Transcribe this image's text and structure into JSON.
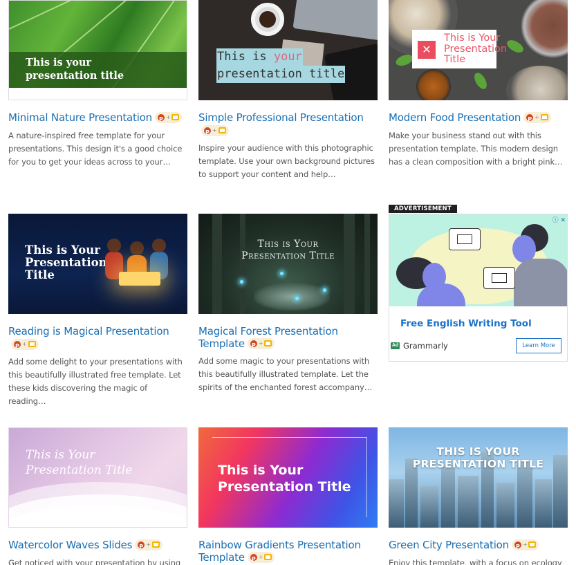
{
  "cards": [
    {
      "title": "Minimal Nature Presentation",
      "thumb_text": [
        "This is your",
        "presentation title"
      ],
      "description": "A nature-inspired free template for your presentations. This design it's a good choice for you to get your ideas across to your…"
    },
    {
      "title": "Simple Professional Presentation",
      "thumb_text": [
        "This is ",
        "your",
        "presentation title"
      ],
      "description": "Inspire your audience with this photographic template. Use your own background pictures to support your content and help…"
    },
    {
      "title": "Modern Food Presentation",
      "thumb_text": [
        "This is Your",
        "Presentation",
        "Title"
      ],
      "thumb_icon": "✕",
      "description": "Make your business stand out with this presentation template. This modern design has a clean composition with a bright pink…"
    },
    {
      "title": "Reading is Magical Presentation",
      "thumb_text": [
        "This is Your",
        "Presentation",
        "Title"
      ],
      "description": "Add some delight to your presentations with this beautifully illustrated free template. Let these kids discovering the magic of reading…"
    },
    {
      "title": "Magical Forest Presentation Template",
      "thumb_text": [
        "This is Your",
        "Presentation Title"
      ],
      "description": "Add some magic to your presentations with this beautifully illustrated template. Let the spirits of the enchanted forest accompany…"
    },
    {
      "title": "Watercolor Waves Slides",
      "thumb_text": [
        "This is Your",
        "Presentation Title"
      ],
      "description": "Get noticed with your presentation by using"
    },
    {
      "title": "Rainbow Gradients Presentation Template",
      "thumb_text": [
        "This is Your",
        "Presentation Title"
      ],
      "description": ""
    },
    {
      "title": "Green City Presentation",
      "thumb_text": [
        "THIS IS YOUR",
        "PRESENTATION TITLE"
      ],
      "description": "Enjoy this template, with a focus on ecology"
    }
  ],
  "badge": {
    "plus": "+"
  },
  "ad": {
    "label": "ADVERTISEMENT",
    "choice_icon": "ⓘ ✕",
    "headline": "Free English Writing Tool",
    "ad_tag": "Ad",
    "brand": "Grammarly",
    "cta": "Learn More"
  },
  "colors": {
    "title_link": "#1b6fb3",
    "ad_headline": "#1a73c8",
    "badge_bg": "#f7eed7",
    "powerpoint": "#d24726",
    "google_slides": "#f4b400"
  }
}
